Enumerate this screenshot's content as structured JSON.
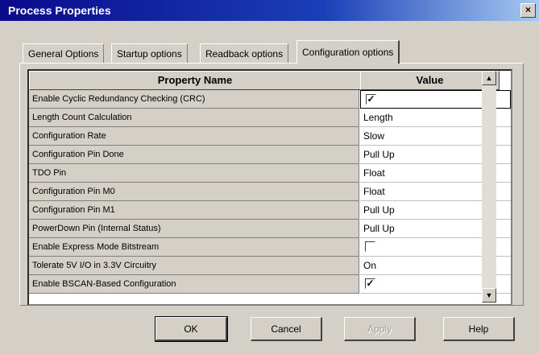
{
  "window": {
    "title": "Process Properties",
    "close_glyph": "×"
  },
  "tabs": [
    {
      "label": "General Options",
      "active": false
    },
    {
      "label": "Startup options",
      "active": false
    },
    {
      "label": "Readback options",
      "active": false
    },
    {
      "label": "Configuration options",
      "active": true
    }
  ],
  "grid": {
    "headers": {
      "name": "Property Name",
      "value": "Value"
    },
    "rows": [
      {
        "name": "Enable Cyclic Redundancy Checking (CRC)",
        "type": "checkbox",
        "checked": true,
        "check_glyph": "✓"
      },
      {
        "name": "Length Count Calculation",
        "type": "text",
        "value": "Length"
      },
      {
        "name": "Configuration Rate",
        "type": "text",
        "value": "Slow"
      },
      {
        "name": "Configuration Pin Done",
        "type": "text",
        "value": "Pull Up"
      },
      {
        "name": "TDO Pin",
        "type": "text",
        "value": "Float"
      },
      {
        "name": "Configuration Pin M0",
        "type": "text",
        "value": "Float"
      },
      {
        "name": "Configuration Pin M1",
        "type": "text",
        "value": "Pull Up"
      },
      {
        "name": "PowerDown Pin (Internal Status)",
        "type": "text",
        "value": "Pull Up"
      },
      {
        "name": "Enable Express Mode Bitstream",
        "type": "checkbox",
        "checked": false,
        "check_glyph": ""
      },
      {
        "name": "Tolerate 5V I/O in 3.3V Circuitry",
        "type": "text",
        "value": "On"
      },
      {
        "name": "Enable BSCAN-Based Configuration",
        "type": "checkbox",
        "checked": true,
        "check_glyph": "✓"
      }
    ]
  },
  "scrollbar": {
    "up_glyph": "▲",
    "down_glyph": "▼"
  },
  "buttons": {
    "ok": "OK",
    "cancel": "Cancel",
    "apply": "Apply",
    "help": "Help"
  }
}
